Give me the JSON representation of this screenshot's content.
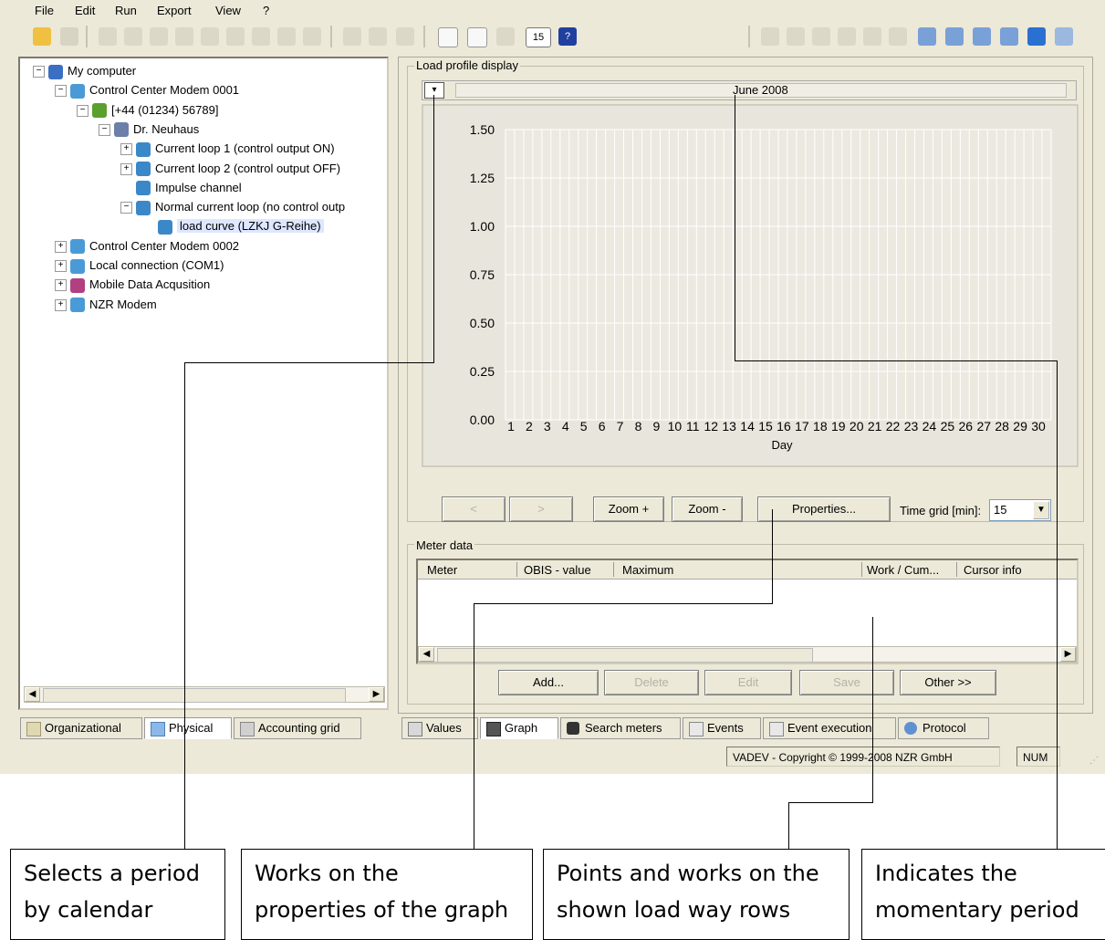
{
  "menu": [
    "File",
    "Edit",
    "Run",
    "Export",
    "View",
    "?"
  ],
  "toolbar": {
    "interval_label": "15"
  },
  "tree": [
    {
      "label": "My computer",
      "level": 0,
      "expander": "−",
      "icon": "computer-icon",
      "color": "#3a6fc4"
    },
    {
      "label": "Control Center Modem 0001",
      "level": 1,
      "expander": "−",
      "icon": "modem-icon",
      "color": "#4a9ad8"
    },
    {
      "label": "[+44 (01234) 56789]",
      "level": 2,
      "expander": "−",
      "icon": "phone-icon",
      "color": "#5aa02c"
    },
    {
      "label": "Dr. Neuhaus",
      "level": 3,
      "expander": "−",
      "icon": "device-icon",
      "color": "#6b7fa8"
    },
    {
      "label": "Current loop 1 (control output ON)",
      "level": 4,
      "expander": "+",
      "icon": "loop-icon",
      "color": "#3b88c8"
    },
    {
      "label": "Current loop 2 (control output OFF)",
      "level": 4,
      "expander": "+",
      "icon": "loop-icon",
      "color": "#3b88c8"
    },
    {
      "label": "Impulse channel",
      "level": 4,
      "expander": "",
      "icon": "impulse-icon",
      "color": "#3b88c8"
    },
    {
      "label": "Normal current loop (no control outp",
      "level": 4,
      "expander": "−",
      "icon": "loop-icon",
      "color": "#3b88c8"
    },
    {
      "label": "load curve (LZKJ G-Reihe)",
      "level": 5,
      "expander": "",
      "icon": "load-curve-icon",
      "color": "#3b88c8",
      "selected": true
    },
    {
      "label": "Control Center Modem 0002",
      "level": 1,
      "expander": "+",
      "icon": "modem-icon",
      "color": "#4a9ad8"
    },
    {
      "label": "Local connection (COM1)",
      "level": 1,
      "expander": "+",
      "icon": "serial-icon",
      "color": "#4a9ad8"
    },
    {
      "label": "Mobile Data Acqusition",
      "level": 1,
      "expander": "+",
      "icon": "mobile-icon",
      "color": "#b04080"
    },
    {
      "label": "NZR Modem",
      "level": 1,
      "expander": "+",
      "icon": "modem-icon",
      "color": "#4a9ad8"
    }
  ],
  "left_tabs": [
    "Organizational",
    "Physical",
    "Accounting grid"
  ],
  "load_profile": {
    "group_label": "Load profile display",
    "period": "June 2008"
  },
  "chart_data": {
    "type": "line",
    "x": [
      "1",
      "2",
      "3",
      "4",
      "5",
      "6",
      "7",
      "8",
      "9",
      "10",
      "11",
      "12",
      "13",
      "14",
      "15",
      "16",
      "17",
      "18",
      "19",
      "20",
      "21",
      "22",
      "23",
      "24",
      "25",
      "26",
      "27",
      "28",
      "29",
      "30"
    ],
    "y_ticks": [
      "0.00",
      "0.25",
      "0.50",
      "0.75",
      "1.00",
      "1.25",
      "1.50"
    ],
    "ylim": [
      0,
      1.5
    ],
    "xlabel": "Day",
    "ylabel": "",
    "series": [],
    "grid": true
  },
  "nav_buttons": {
    "prev": "<",
    "next": ">",
    "zoom_in": "Zoom +",
    "zoom_out": "Zoom -",
    "properties": "Properties...",
    "time_grid_label": "Time grid [min]:",
    "time_grid_value": "15"
  },
  "meter_data": {
    "group_label": "Meter data",
    "columns": [
      "Meter",
      "OBIS - value",
      "Maximum",
      "Work / Cum...",
      "Cursor info"
    ]
  },
  "action_buttons": [
    "Add...",
    "Delete",
    "Edit",
    "Save",
    "Other >>"
  ],
  "right_tabs": [
    "Values",
    "Graph",
    "Search meters",
    "Events",
    "Event execution",
    "Protocol"
  ],
  "status": {
    "copyright": "VADEV - Copyright © 1999-2008 NZR GmbH",
    "num": "NUM"
  },
  "callouts": [
    {
      "line1": "Selects a period",
      "line2": "by calendar"
    },
    {
      "line1": "Works on the",
      "line2": "properties of the graph"
    },
    {
      "line1": "Points and works on the",
      "line2": "shown load way rows"
    },
    {
      "line1": "Indicates the",
      "line2": "momentary period"
    }
  ]
}
